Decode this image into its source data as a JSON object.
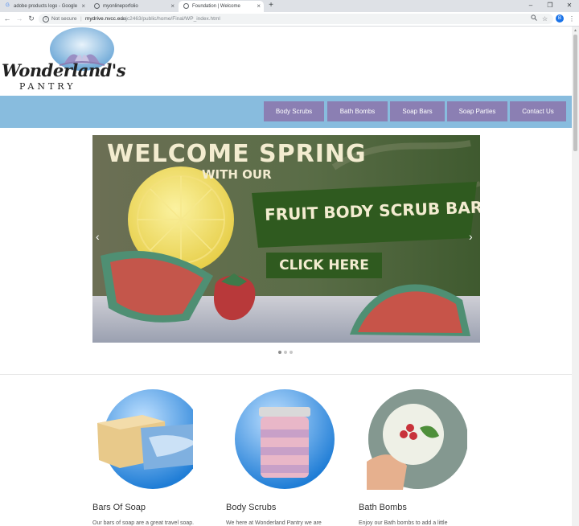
{
  "browser": {
    "tabs": [
      {
        "title": "adobe products logo - Google S",
        "favicon": "G",
        "active": false
      },
      {
        "title": "myonlineporfolio",
        "favicon": "",
        "active": false
      },
      {
        "title": "Foundation | Welcome",
        "favicon": "",
        "active": true
      }
    ],
    "new_tab": "+",
    "minimize": "–",
    "maximize": "❐",
    "close": "✕",
    "not_secure": "Not secure",
    "url_host": "mydrive.nvcc.edu",
    "url_path": "/ajc2463/public/home/Final/WP_index.html",
    "profile_initial": "B"
  },
  "site": {
    "logo_script": "Wonderland's",
    "logo_sub": "PANTRY",
    "nav": [
      "Body Scrubs",
      "Bath Bombs",
      "Soap Bars",
      "Soap Parties",
      "Contact Us"
    ]
  },
  "slider": {
    "line1": "WELCOME SPRING",
    "line2": "WITH OUR",
    "banner": "FRUIT BODY SCRUB BARS",
    "cta": "CLICK HERE",
    "prev": "‹",
    "next": "›"
  },
  "features": [
    {
      "title": "Bars Of Soap",
      "text": "Our bars of soap are a great travel soap."
    },
    {
      "title": "Body Scrubs",
      "text": "We here at Wonderland Pantry we are"
    },
    {
      "title": "Bath Bombs",
      "text": "Enjoy our Bath bombs to add a little"
    }
  ],
  "colors": {
    "nav_bar": "#88bcde",
    "nav_button": "#8b7fb3",
    "feature_circle": "#3a8fd9"
  }
}
